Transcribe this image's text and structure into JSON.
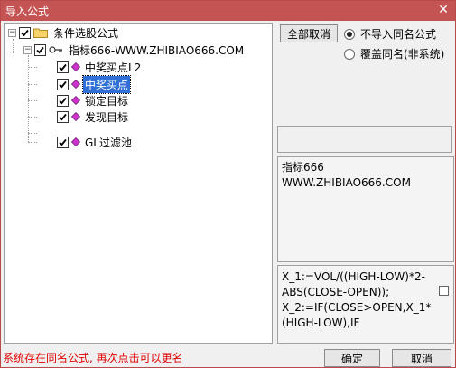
{
  "window": {
    "title": "导入公式",
    "close_glyph": "✕"
  },
  "tree": {
    "root_label": "条件选股公式",
    "formula_label": "指标666-WWW.ZHIBIAO666.COM",
    "items": [
      {
        "label": "中奖买点L2",
        "checked": true,
        "selected": false
      },
      {
        "label": "中奖买点",
        "checked": true,
        "selected": true
      },
      {
        "label": "锁定目标",
        "checked": true,
        "selected": false
      },
      {
        "label": "发现目标",
        "checked": true,
        "selected": false
      },
      {
        "label": "GL过滤池",
        "checked": true,
        "selected": false
      }
    ]
  },
  "buttons": {
    "deselect_all": "全部取消",
    "ok": "确定",
    "cancel": "取消"
  },
  "options": {
    "no_import_same": "不导入同名公式",
    "overwrite_same": "覆盖同名(非系统)",
    "selected": "no_import_same"
  },
  "info": {
    "line1": "指标666",
    "line2": "WWW.ZHIBIAO666.COM"
  },
  "code": {
    "line1": "X_1:=VOL/((HIGH-LOW)*2-",
    "line2": "ABS(CLOSE-OPEN));",
    "line3": "X_2:=IF(CLOSE>OPEN,X_1*",
    "line4": "(HIGH-LOW),IF"
  },
  "status": "系统存在同名公式, 再次点击可以更名",
  "colors": {
    "titlebar": "#c45454",
    "selection": "#2f6fd6",
    "status_text": "#e00000",
    "gem": "#cc33cc"
  }
}
